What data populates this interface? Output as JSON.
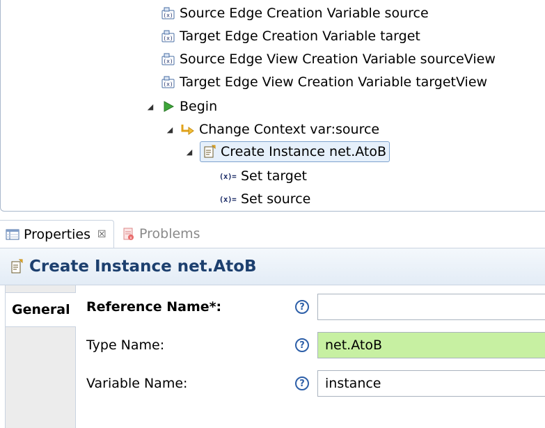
{
  "tree": {
    "nodes": [
      {
        "label": "Source Edge Creation Variable source",
        "icon": "variable-icon"
      },
      {
        "label": "Target Edge Creation Variable target",
        "icon": "variable-icon"
      },
      {
        "label": "Source Edge View Creation Variable sourceView",
        "icon": "variable-icon"
      },
      {
        "label": "Target Edge View Creation Variable targetView",
        "icon": "variable-icon"
      },
      {
        "label": "Begin",
        "icon": "play-icon"
      },
      {
        "label": "Change Context var:source",
        "icon": "change-context-icon"
      },
      {
        "label": "Create Instance net.AtoB",
        "icon": "create-instance-icon"
      },
      {
        "label": "Set target",
        "icon": "set-value-icon",
        "icon_text": "(x)="
      },
      {
        "label": "Set source",
        "icon": "set-value-icon",
        "icon_text": "(x)="
      }
    ]
  },
  "tabs": {
    "properties": "Properties",
    "properties_close": "☒",
    "problems": "Problems"
  },
  "header": {
    "title": "Create Instance net.AtoB"
  },
  "side_tabs": {
    "general": "General"
  },
  "form": {
    "help_glyph": "?",
    "reference_name": {
      "label": "Reference Name*:",
      "value": ""
    },
    "type_name": {
      "label": "Type Name:",
      "value": "net.AtoB"
    },
    "variable_name": {
      "label": "Variable Name:",
      "value": "instance"
    }
  },
  "colors": {
    "selection": "#e6f0fb",
    "header_title": "#1c3f6e",
    "valid_field": "#c7f0a2",
    "help": "#2d5fa8"
  }
}
